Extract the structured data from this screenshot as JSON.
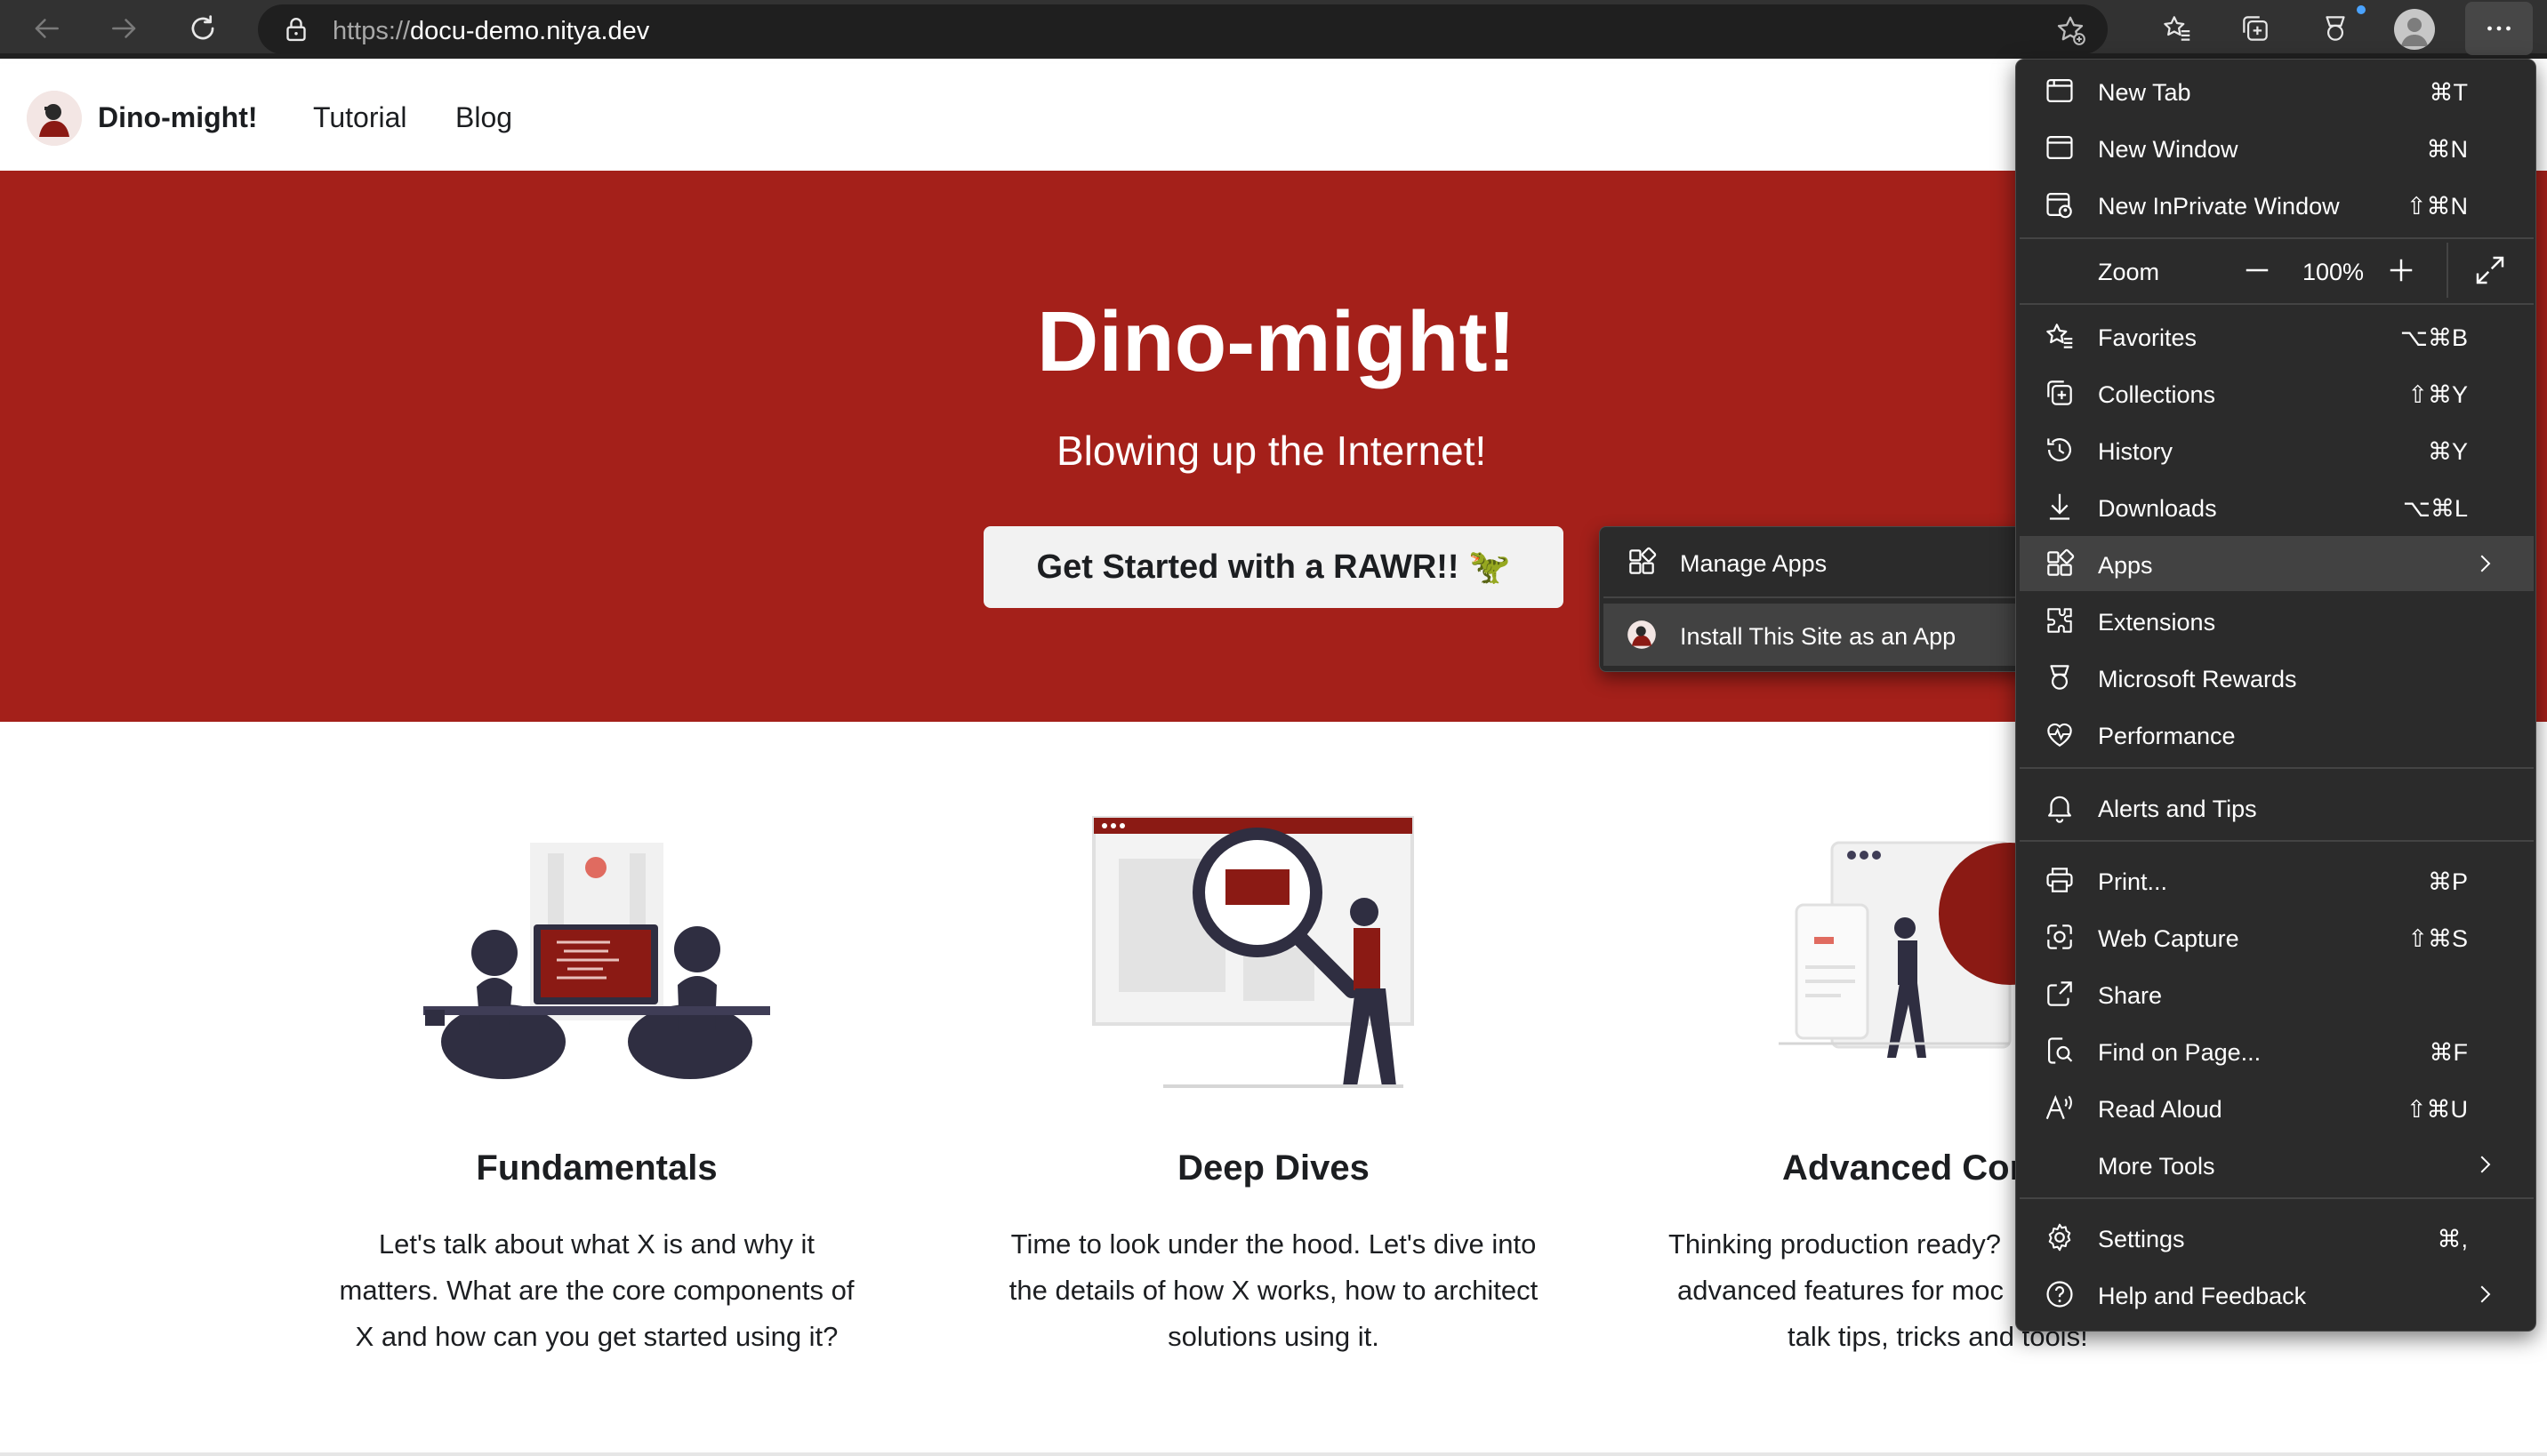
{
  "browser": {
    "url_protocol": "https://",
    "url_host": "docu-demo.nitya.dev"
  },
  "site": {
    "brand": "Dino-might!",
    "nav": [
      "Tutorial",
      "Blog"
    ]
  },
  "hero": {
    "title": "Dino-might!",
    "subtitle": "Blowing up the Internet!",
    "cta": "Get Started with a RAWR!! 🦖"
  },
  "features": [
    {
      "title": "Fundamentals",
      "lines": [
        "Let's talk about what X is and why it",
        "matters. What are the core components of",
        "X and how can you get started using it?"
      ]
    },
    {
      "title": "Deep Dives",
      "lines": [
        "Time to look under the hood. Let's dive into",
        "the details of how X works, how to architect",
        "solutions using it."
      ]
    },
    {
      "title": "Advanced Cor",
      "lines": [
        "Thinking production ready?",
        "advanced features for moc",
        "talk tips, tricks and tools!"
      ]
    }
  ],
  "menu": {
    "items": [
      {
        "label": "New Tab",
        "shortcut": "⌘T",
        "icon": "new-tab-icon"
      },
      {
        "label": "New Window",
        "shortcut": "⌘N",
        "icon": "new-window-icon"
      },
      {
        "label": "New InPrivate Window",
        "shortcut": "⇧⌘N",
        "icon": "inprivate-icon"
      },
      {
        "label": "Favorites",
        "shortcut": "⌥⌘B",
        "icon": "favorites-icon"
      },
      {
        "label": "Collections",
        "shortcut": "⇧⌘Y",
        "icon": "collections-icon"
      },
      {
        "label": "History",
        "shortcut": "⌘Y",
        "icon": "history-icon"
      },
      {
        "label": "Downloads",
        "shortcut": "⌥⌘L",
        "icon": "download-icon"
      },
      {
        "label": "Apps",
        "shortcut": "",
        "icon": "apps-icon"
      },
      {
        "label": "Extensions",
        "shortcut": "",
        "icon": "extensions-icon"
      },
      {
        "label": "Microsoft Rewards",
        "shortcut": "",
        "icon": "rewards-icon"
      },
      {
        "label": "Performance",
        "shortcut": "",
        "icon": "performance-icon"
      },
      {
        "label": "Alerts and Tips",
        "shortcut": "",
        "icon": "bell-icon"
      },
      {
        "label": "Print...",
        "shortcut": "⌘P",
        "icon": "print-icon"
      },
      {
        "label": "Web Capture",
        "shortcut": "⇧⌘S",
        "icon": "web-capture-icon"
      },
      {
        "label": "Share",
        "shortcut": "",
        "icon": "share-icon"
      },
      {
        "label": "Find on Page...",
        "shortcut": "⌘F",
        "icon": "find-icon"
      },
      {
        "label": "Read Aloud",
        "shortcut": "⇧⌘U",
        "icon": "read-aloud-icon"
      },
      {
        "label": "More Tools",
        "shortcut": "",
        "icon": ""
      },
      {
        "label": "Settings",
        "shortcut": "⌘,",
        "icon": "gear-icon"
      },
      {
        "label": "Help and Feedback",
        "shortcut": "",
        "icon": "help-icon"
      }
    ],
    "zoom_label": "Zoom",
    "zoom_value": "100%"
  },
  "apps_submenu": {
    "items": [
      "Manage Apps",
      "Install This Site as an App"
    ]
  },
  "colors": {
    "hero": "#a4201a",
    "menu_bg": "#2b2b2b",
    "menu_highlight": "#424242",
    "toolbar": "#323232"
  }
}
